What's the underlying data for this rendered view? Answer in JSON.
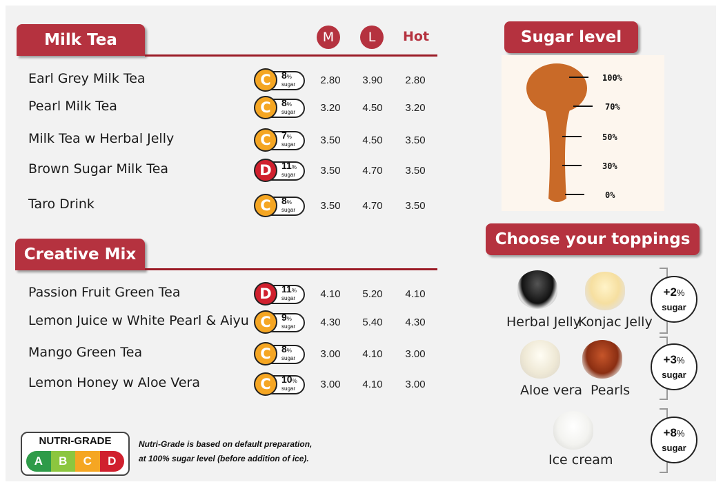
{
  "milk_tea": {
    "title": "Milk Tea",
    "sizes": {
      "m": "M",
      "l": "L",
      "hot": "Hot"
    },
    "items": [
      {
        "name": "Earl Grey Milk Tea",
        "grade": "C",
        "sugar_pct": "8",
        "pct_sign": "%",
        "sugar_word": "sugar",
        "m": "2.80",
        "l": "3.90",
        "hot": "2.80"
      },
      {
        "name": "Pearl Milk Tea",
        "grade": "C",
        "sugar_pct": "8",
        "pct_sign": "%",
        "sugar_word": "sugar",
        "m": "3.20",
        "l": "4.50",
        "hot": "3.20"
      },
      {
        "name": "Milk Tea w Herbal Jelly",
        "grade": "C",
        "sugar_pct": "7",
        "pct_sign": "%",
        "sugar_word": "sugar",
        "m": "3.50",
        "l": "4.50",
        "hot": "3.50"
      },
      {
        "name": "Brown Sugar Milk Tea",
        "grade": "D",
        "sugar_pct": "11",
        "pct_sign": "%",
        "sugar_word": "sugar",
        "m": "3.50",
        "l": "4.70",
        "hot": "3.50"
      },
      {
        "name": "Taro Drink",
        "grade": "C",
        "sugar_pct": "8",
        "pct_sign": "%",
        "sugar_word": "sugar",
        "m": "3.50",
        "l": "4.70",
        "hot": "3.50"
      }
    ]
  },
  "creative_mix": {
    "title": "Creative Mix",
    "items": [
      {
        "name": "Passion  Fruit Green Tea",
        "grade": "D",
        "sugar_pct": "11",
        "pct_sign": "%",
        "sugar_word": "sugar",
        "m": "4.10",
        "l": "5.20",
        "hot": "4.10"
      },
      {
        "name": "Lemon Juice w White Pearl & Aiyu",
        "grade": "C",
        "sugar_pct": "9",
        "pct_sign": "%",
        "sugar_word": "sugar",
        "m": "4.30",
        "l": "5.40",
        "hot": "4.30"
      },
      {
        "name": "Mango Green Tea",
        "grade": "C",
        "sugar_pct": "8",
        "pct_sign": "%",
        "sugar_word": "sugar",
        "m": "3.00",
        "l": "4.10",
        "hot": "3.00"
      },
      {
        "name": "Lemon Honey w Aloe Vera",
        "grade": "C",
        "sugar_pct": "10",
        "pct_sign": "%",
        "sugar_word": "sugar",
        "m": "3.00",
        "l": "4.10",
        "hot": "3.00"
      }
    ]
  },
  "nutri_grade": {
    "title": "NUTRI-GRADE",
    "grades": [
      "A",
      "B",
      "C",
      "D"
    ],
    "grade_colors": [
      "#2e9b49",
      "#8cc63f",
      "#f5a623",
      "#d0202e"
    ],
    "note_line1": "Nutri-Grade is based on default preparation,",
    "note_line2": "at 100% sugar level (before addition of ice)."
  },
  "sugar_level": {
    "title": "Sugar level",
    "levels": [
      "100%",
      "70%",
      "50%",
      "30%",
      "0%"
    ],
    "spoon_color": "#c96a28"
  },
  "toppings": {
    "title": "Choose your toppings",
    "items": {
      "herbal_jelly": "Herbal Jelly",
      "konjac_jelly": "Konjac Jelly",
      "aloe_vera": "Aloe vera",
      "pearls": "Pearls",
      "ice_cream": "Ice cream"
    },
    "add_ons": [
      {
        "amount": "+2",
        "pct": "%",
        "label": "sugar"
      },
      {
        "amount": "+3",
        "pct": "%",
        "label": "sugar"
      },
      {
        "amount": "+8",
        "pct": "%",
        "label": "sugar"
      }
    ]
  },
  "colors": {
    "brand_red": "#b5323f",
    "rule_red": "#9b1b26",
    "background": "#f2f2f2"
  }
}
